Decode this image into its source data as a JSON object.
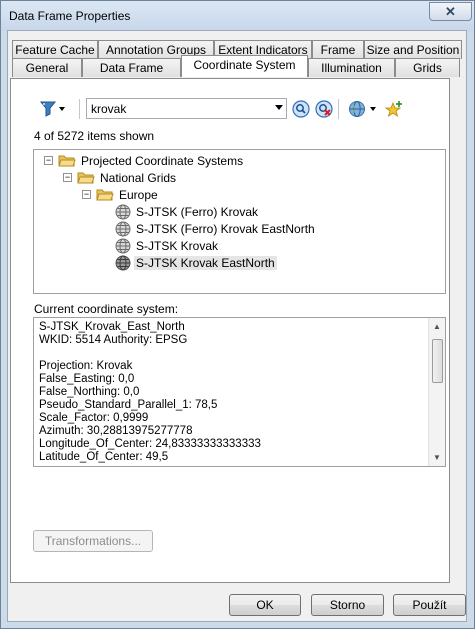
{
  "window": {
    "title": "Data Frame Properties",
    "close_glyph": "✕"
  },
  "tabs": {
    "row_back": [
      "Feature Cache",
      "Annotation Groups",
      "Extent Indicators",
      "Frame",
      "Size and Position"
    ],
    "row_front": [
      "General",
      "Data Frame",
      "Coordinate System",
      "Illumination",
      "Grids"
    ],
    "active": "Coordinate System"
  },
  "toolbar": {
    "filter_icon": "filter-icon",
    "search_value": "krovak",
    "search_icon": "search-icon",
    "clear_search_icon": "clear-search-icon",
    "globe_icon": "globe-icon",
    "add_favorite_icon": "add-favorite-icon"
  },
  "count_text": "4 of 5272 items shown",
  "tree": {
    "root": "Projected Coordinate Systems",
    "group": "National Grids",
    "subgroup": "Europe",
    "items": [
      "S-JTSK (Ferro) Krovak",
      "S-JTSK (Ferro) Krovak EastNorth",
      "S-JTSK Krovak",
      "S-JTSK Krovak EastNorth"
    ],
    "selected": "S-JTSK Krovak EastNorth",
    "expander_glyph": "−"
  },
  "current_label": "Current coordinate system:",
  "details": [
    "S-JTSK_Krovak_East_North",
    "WKID: 5514 Authority: EPSG",
    "",
    "Projection: Krovak",
    "False_Easting: 0,0",
    "False_Northing: 0,0",
    "Pseudo_Standard_Parallel_1: 78,5",
    "Scale_Factor: 0,9999",
    "Azimuth: 30,28813975277778",
    "Longitude_Of_Center: 24,83333333333333",
    "Latitude_Of_Center: 49,5"
  ],
  "buttons": {
    "transformations": "Transformations...",
    "ok": "OK",
    "cancel": "Storno",
    "apply": "Použít"
  },
  "colors": {
    "title_bar": "#ccdbea",
    "folder": "#e8c35a",
    "selection": "#e5e5e5"
  }
}
